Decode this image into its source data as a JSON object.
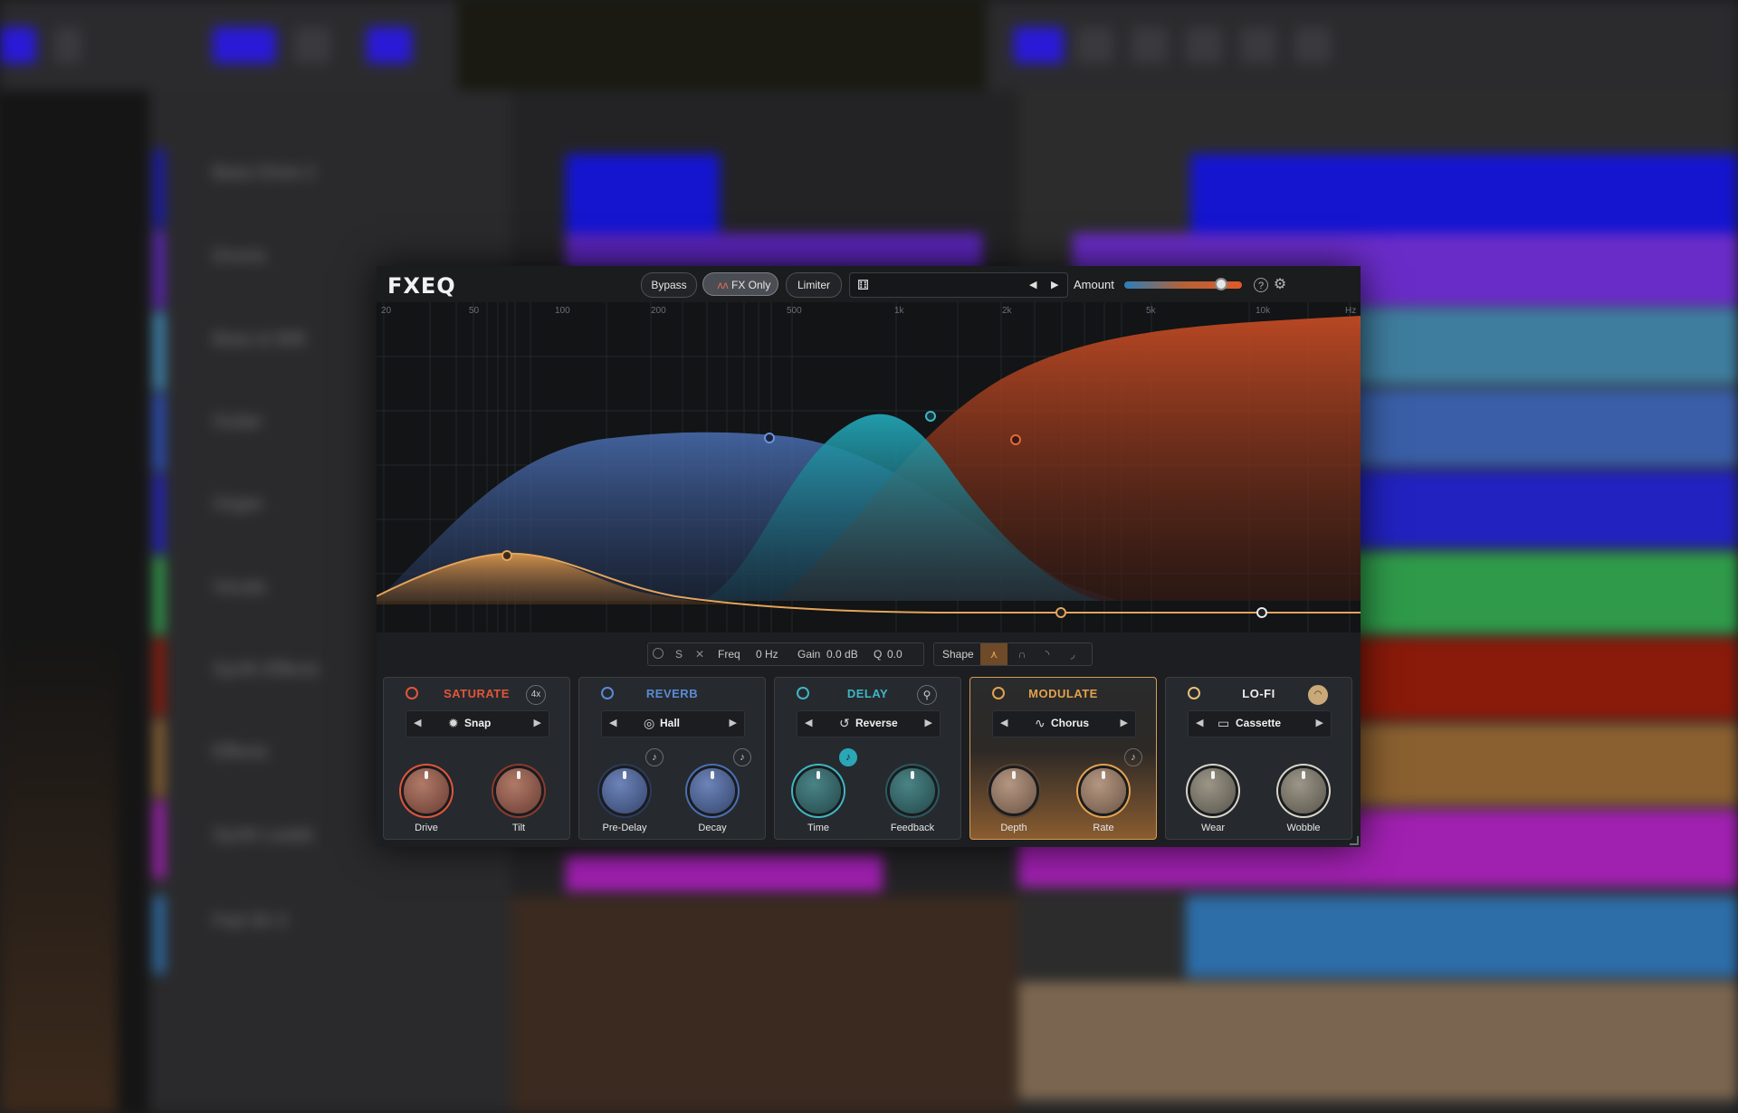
{
  "plugin": {
    "title": "FXEQ",
    "buttons": {
      "bypass": "Bypass",
      "fx_only": "FX Only",
      "limiter": "Limiter"
    },
    "amount": {
      "label": "Amount",
      "level": 0.82
    },
    "freq_labels": [
      "20",
      "50",
      "100",
      "200",
      "500",
      "1k",
      "2k",
      "5k",
      "10k",
      "Hz"
    ]
  },
  "band": {
    "solo": "S",
    "freq_label": "Freq",
    "freq_value": "0 Hz",
    "gain_label": "Gain",
    "gain_value": "0.0 dB",
    "q_label": "Q",
    "q_value": "0.0",
    "shape_label": "Shape"
  },
  "modules": [
    {
      "title": "SATURATE",
      "badge": "4x",
      "selector": "Snap",
      "knobs": [
        "Drive",
        "Tilt"
      ],
      "color": "#e2553b"
    },
    {
      "title": "REVERB",
      "selector": "Hall",
      "knobs": [
        "Pre-Delay",
        "Decay"
      ],
      "color": "#5b8ad6"
    },
    {
      "title": "DELAY",
      "selector": "Reverse",
      "knobs": [
        "Time",
        "Feedback"
      ],
      "color": "#3fb6c4"
    },
    {
      "title": "MODULATE",
      "selector": "Chorus",
      "knobs": [
        "Depth",
        "Rate"
      ],
      "color": "#e2a24e"
    },
    {
      "title": "LO-FI",
      "selector": "Cassette",
      "knobs": [
        "Wear",
        "Wobble"
      ],
      "color": "#e8e8e8"
    }
  ],
  "background_tracks": [
    "Bass Drive 2",
    "Drums",
    "Bass & 808",
    "Guitar",
    "Organ",
    "Vocals",
    "Synth Effects",
    "Effects",
    "Synth Leads",
    "Pad Sh 3"
  ],
  "icons": [
    "dice-icon",
    "help-icon",
    "gear-icon",
    "power-icon",
    "note-icon"
  ]
}
